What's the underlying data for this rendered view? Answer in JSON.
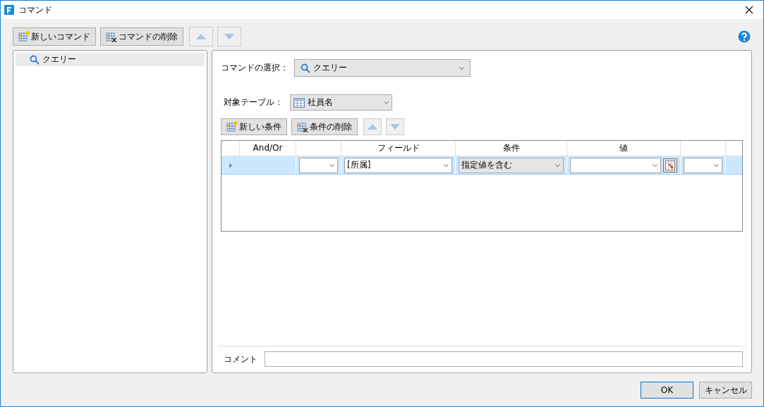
{
  "window": {
    "title": "コマンド"
  },
  "toolbar": [
    {
      "kind": "new",
      "label": "新しいコマンド",
      "disabled": false
    },
    {
      "kind": "delete",
      "label": "コマンドの削除",
      "disabled": false
    },
    {
      "kind": "up",
      "disabled": true
    },
    {
      "kind": "down",
      "disabled": true
    }
  ],
  "commands": [
    {
      "label": "クエリー",
      "selected": true
    }
  ],
  "command_select": {
    "label": "コマンドの選択：",
    "value": "クエリー"
  },
  "target_table": {
    "label": "対象テーブル：",
    "value": "社員名"
  },
  "condition_toolbar": [
    {
      "kind": "new",
      "label": "新しい条件",
      "disabled": false
    },
    {
      "kind": "delete",
      "label": "条件の削除",
      "disabled": false
    },
    {
      "kind": "up",
      "disabled": true
    },
    {
      "kind": "down",
      "disabled": true
    }
  ],
  "grid": {
    "columns": [
      {
        "label": "And/Or"
      },
      {},
      {
        "label": "フィールド"
      },
      {
        "label": "条件"
      },
      {
        "label": "値"
      },
      {}
    ],
    "rows": [
      {
        "selected": true,
        "cells": [
          {
            "kind": "blank"
          },
          {
            "kind": "combo"
          },
          {
            "kind": "combo",
            "value": "[所属]"
          },
          {
            "kind": "dropdown",
            "value": "指定値を含む"
          },
          {
            "kind": "combo-picker"
          },
          {
            "kind": "combo"
          }
        ]
      }
    ]
  },
  "comment": {
    "label": "コメント"
  },
  "buttons": [
    {
      "label": "OK",
      "default": true
    },
    {
      "label": "キャンセル",
      "default": false
    }
  ]
}
